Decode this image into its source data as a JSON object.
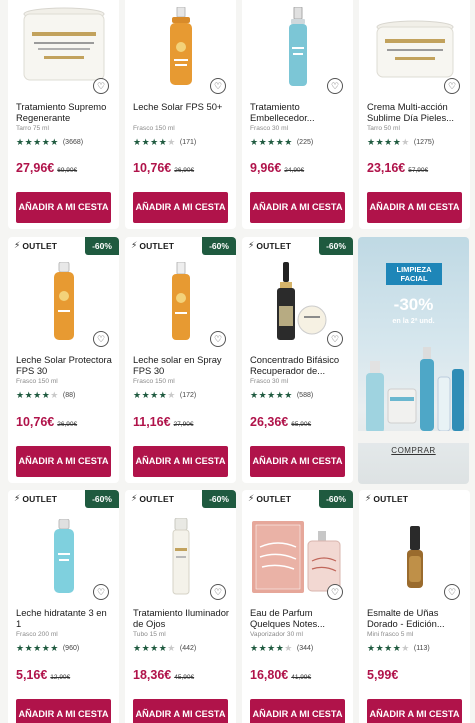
{
  "products_row1": [
    {
      "title": "Tratamiento Supremo Regenerante",
      "size": "Tarro 75 ml",
      "stars": 5,
      "reviews": "(3668)",
      "price": "27,96€",
      "was": "69,90€",
      "cta": "AÑADIR A MI CESTA"
    },
    {
      "title": "Leche Solar FPS 50+",
      "size": "Frasco 150 ml",
      "stars": 4,
      "reviews": "(171)",
      "price": "10,76€",
      "was": "26,90€",
      "cta": "AÑADIR A MI CESTA"
    },
    {
      "title": "Tratamiento Embellecedor...",
      "size": "Frasco 30 ml",
      "stars": 5,
      "reviews": "(225)",
      "price": "9,96€",
      "was": "24,90€",
      "cta": "AÑADIR A MI CESTA"
    },
    {
      "title": "Crema Multi-acción Sublime Día Pieles...",
      "size": "Tarro 50 ml",
      "stars": 4.5,
      "reviews": "(1275)",
      "price": "23,16€",
      "was": "57,90€",
      "cta": "AÑADIR A MI CESTA"
    }
  ],
  "products_row2": [
    {
      "outlet": "OUTLET",
      "discount": "-60%",
      "title": "Leche Solar Protectora FPS 30",
      "size": "Frasco 150 ml",
      "stars": 4.5,
      "reviews": "(88)",
      "price": "10,76€",
      "was": "26,90€",
      "cta": "AÑADIR A MI CESTA"
    },
    {
      "outlet": "OUTLET",
      "discount": "-60%",
      "title": "Leche solar en Spray FPS 30",
      "size": "Frasco 150 ml",
      "stars": 4.5,
      "reviews": "(172)",
      "price": "11,16€",
      "was": "27,90€",
      "cta": "AÑADIR A MI CESTA"
    },
    {
      "outlet": "OUTLET",
      "discount": "-60%",
      "title": "Concentrado Bifásico Recuperador de...",
      "size": "Frasco 30 ml",
      "stars": 5,
      "reviews": "(588)",
      "price": "26,36€",
      "was": "65,90€",
      "cta": "AÑADIR A MI CESTA"
    }
  ],
  "promo": {
    "badge": "LIMPIEZA FACIAL",
    "percent": "-30%",
    "subtitle": "en la 2ª und.",
    "link": "COMPRAR"
  },
  "products_row3": [
    {
      "outlet": "OUTLET",
      "discount": "-60%",
      "title": "Leche hidratante 3 en 1",
      "size": "Frasco 200 ml",
      "stars": 5,
      "reviews": "(960)",
      "price": "5,16€",
      "was": "12,90€",
      "cta": "AÑADIR A MI CESTA"
    },
    {
      "outlet": "OUTLET",
      "discount": "-60%",
      "title": "Tratamiento Iluminador de Ojos",
      "size": "Tubo 15 ml",
      "stars": 4.5,
      "reviews": "(442)",
      "price": "18,36€",
      "was": "45,90€",
      "cta": "AÑADIR A MI CESTA"
    },
    {
      "outlet": "OUTLET",
      "discount": "-60%",
      "title": "Eau de Parfum Quelques Notes...",
      "size": "Vaporizador 30 ml",
      "stars": 4.5,
      "reviews": "(344)",
      "price": "16,80€",
      "was": "41,99€",
      "cta": "AÑADIR A MI CESTA"
    },
    {
      "outlet": "OUTLET",
      "discount": "",
      "title": "Esmalte de Uñas Dorado - Edición...",
      "size": "Mini frasco 5 ml",
      "stars": 4.5,
      "reviews": "(113)",
      "price": "5,99€",
      "was": "",
      "cta": "AÑADIR A MI CESTA"
    }
  ],
  "colors": {
    "accent": "#b0134a",
    "discount_badge": "#1f5a3f",
    "stars": "#1f5a3f",
    "promo_badge": "#1e86b8"
  }
}
